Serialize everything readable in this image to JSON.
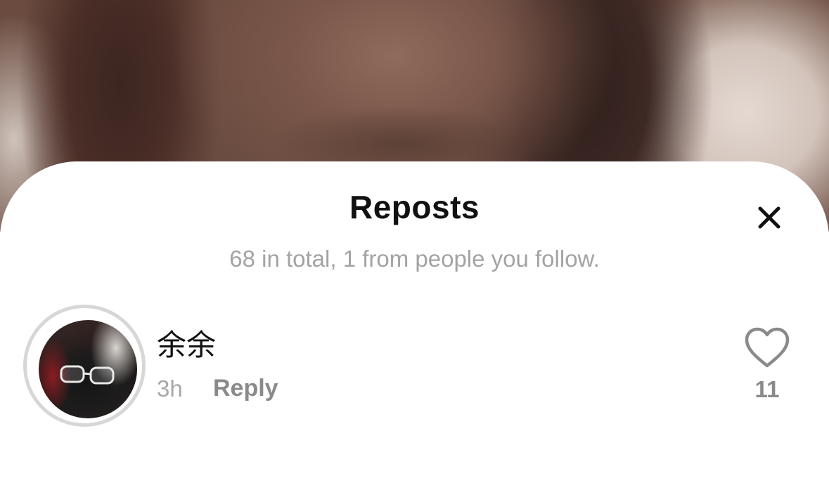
{
  "sheet": {
    "title": "Reposts",
    "subtitle": "68 in total, 1 from people you follow."
  },
  "reposts": [
    {
      "username": "余余",
      "time": "3h",
      "reply_label": "Reply",
      "like_count": "11"
    }
  ],
  "icons": {
    "close": "close-icon",
    "like": "heart-outline-icon"
  },
  "colors": {
    "title": "#111111",
    "subtitle": "#a3a3a3",
    "secondary_text": "#8a8a8a",
    "avatar_ring": "#d7d7d7",
    "sheet_background": "#ffffff"
  }
}
